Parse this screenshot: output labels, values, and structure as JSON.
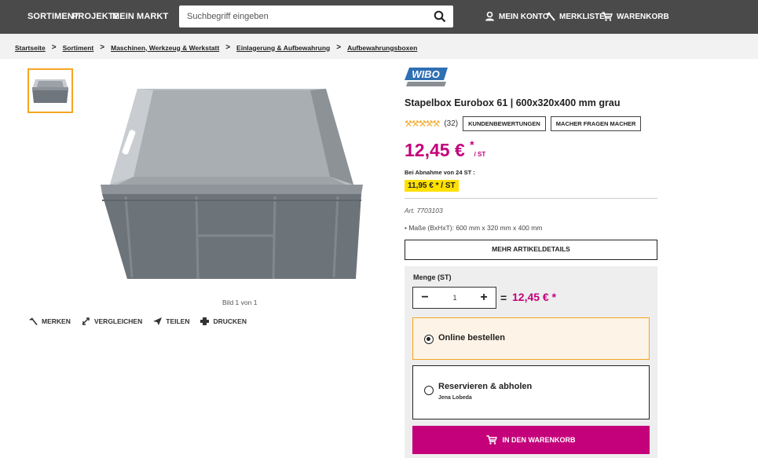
{
  "header": {
    "nav": [
      "SORTIMENT",
      "PROJEKTE",
      "MEIN MARKT"
    ],
    "search_placeholder": "Suchbegriff eingeben",
    "account": "MEIN KONTO",
    "wishlist": "MERKLISTE",
    "cart": "WARENKORB",
    "colors": {
      "bar": "#4a4a4a",
      "accent": "#c4007a",
      "highlight": "#f5a623"
    }
  },
  "breadcrumb": [
    "Startseite",
    "Sortiment",
    "Maschinen, Werkzeug & Werkstatt",
    "Einlagerung & Aufbewahrung",
    "Aufbewahrungsboxen"
  ],
  "gallery": {
    "caption": "Bild 1 von 1",
    "actions": [
      "MERKEN",
      "VERGLEICHEN",
      "TEILEN",
      "DRUCKEN"
    ]
  },
  "product": {
    "brand": "WIBO",
    "title": "Stapelbox Eurobox 61 | 600x320x400 mm grau",
    "rating_count": "(32)",
    "reviews_button": "KUNDENBEWERTUNGEN",
    "questions_button": "MACHER FRAGEN MACHER",
    "price": "12,45 €",
    "price_star": "*",
    "price_unit": "/ ST",
    "bulk_label": "Bei Abnahme von 24 ST :",
    "bulk_price": "11,95 € * / ST",
    "article": "Art. 7703103",
    "spec": "Maße (BxHxT): 600 mm x 320 mm x 400 mm",
    "details_button": "MEHR ARTIKELDETAILS"
  },
  "order": {
    "qty_label": "Menge (ST)",
    "qty_value": "1",
    "minus": "−",
    "plus": "+",
    "equals": "=",
    "total": "12,45 € *",
    "option_online": "Online bestellen",
    "option_reserve": "Reservieren & abholen",
    "store": "Jena Lobeda",
    "cart_button": "IN DEN WARENKORB"
  }
}
